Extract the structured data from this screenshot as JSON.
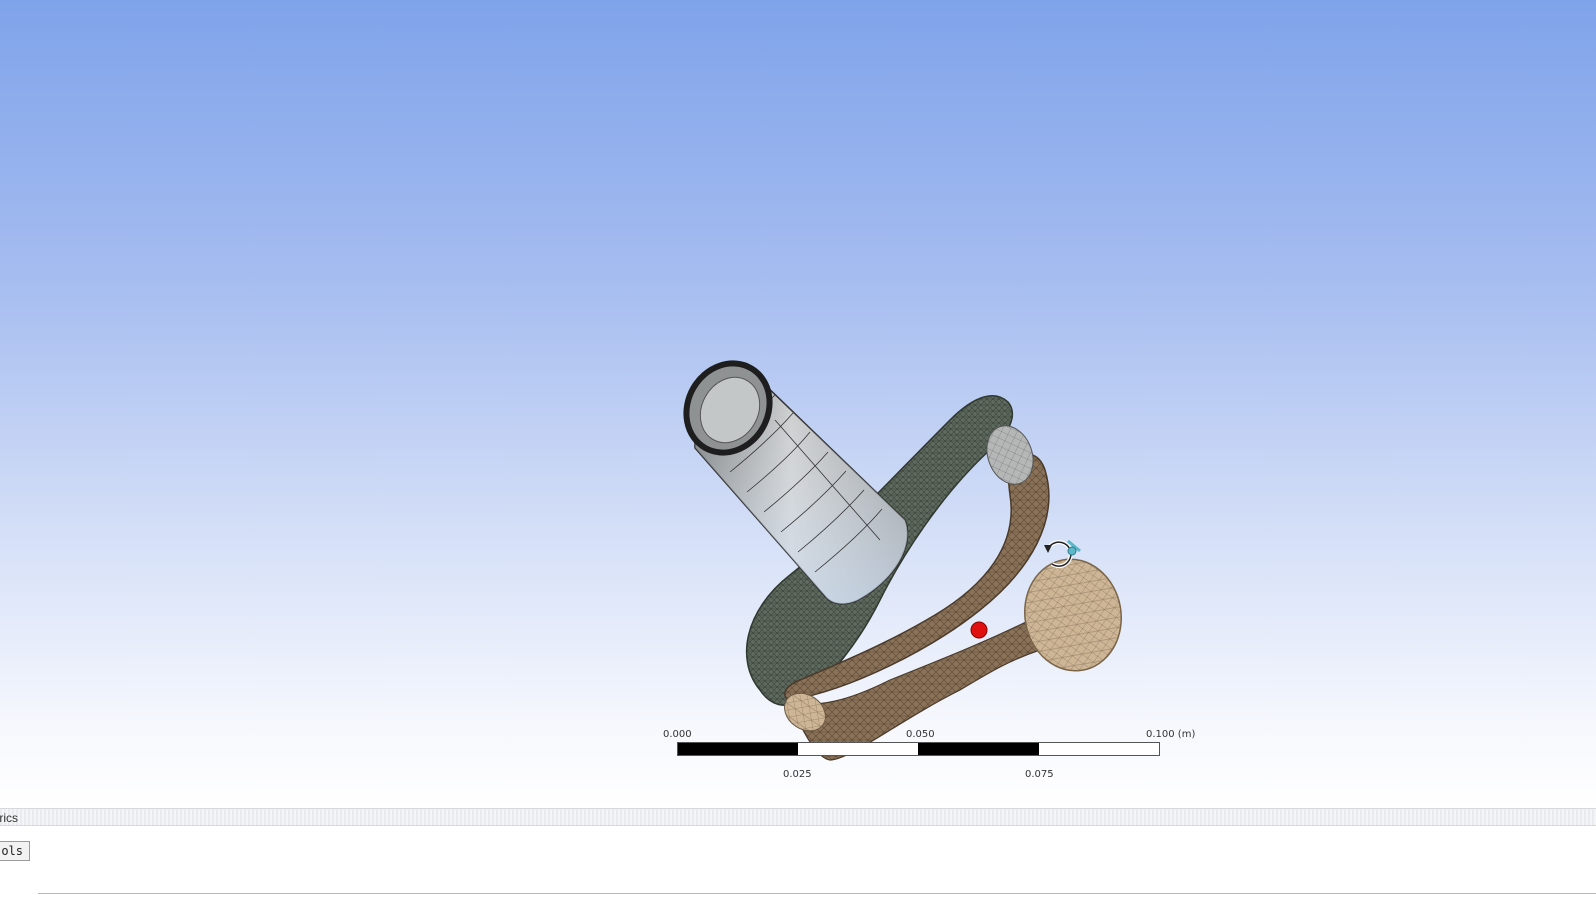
{
  "viewport": {
    "background_top": "#7fa3ea",
    "background_bottom": "#ffffff",
    "model": "meshed-bracket-assembly",
    "rotate_cursor_icon": "rotate-cursor-icon",
    "marker_color": "#e01010"
  },
  "scale_bar": {
    "top_labels": [
      "0.000",
      "0.050",
      "0.100 (m)"
    ],
    "bottom_labels": [
      "0.025",
      "0.075"
    ]
  },
  "panel": {
    "title": "trics",
    "tools_button_label": "ols"
  }
}
